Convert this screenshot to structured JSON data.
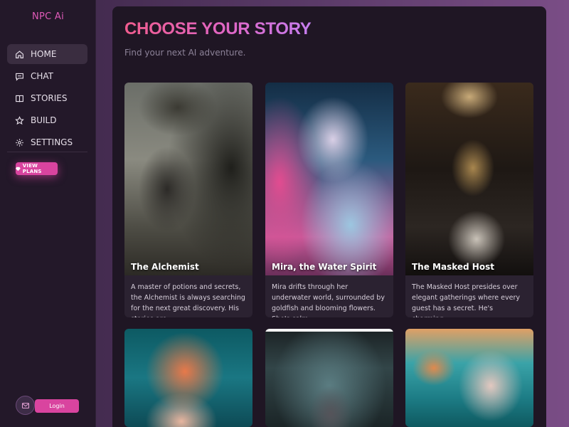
{
  "sidebar": {
    "brand": "NPC Ai",
    "nav": [
      {
        "label": "HOME",
        "icon": "home-icon",
        "active": true
      },
      {
        "label": "CHAT",
        "icon": "chat-icon",
        "active": false
      },
      {
        "label": "STORIES",
        "icon": "book-icon",
        "active": false
      },
      {
        "label": "BUILD",
        "icon": "star-icon",
        "active": false
      },
      {
        "label": "SETTINGS",
        "icon": "gear-icon",
        "active": false
      }
    ],
    "plans_label": "VIEW PLANS",
    "login_label": "Login"
  },
  "main": {
    "title": "CHOOSE YOUR STORY",
    "subtitle": "Find your next AI adventure.",
    "cards": [
      {
        "name": "The Alchemist",
        "desc": "A master of potions and secrets, the Alchemist is always searching for the next great discovery. His stories are..."
      },
      {
        "name": "Mira, the Water Spirit",
        "desc": "Mira drifts through her underwater world, surrounded by goldfish and blooming flowers. She's calm,..."
      },
      {
        "name": "The Masked Host",
        "desc": "The Masked Host presides over elegant gatherings where every guest has a secret. He's charming,..."
      },
      {
        "name": "",
        "desc": ""
      },
      {
        "name": "",
        "desc": ""
      },
      {
        "name": "",
        "desc": ""
      }
    ]
  },
  "colors": {
    "accent": "#d9449f",
    "brand": "#e05ab8",
    "title_gradient": [
      "#f05c8e",
      "#c57ef0"
    ]
  }
}
